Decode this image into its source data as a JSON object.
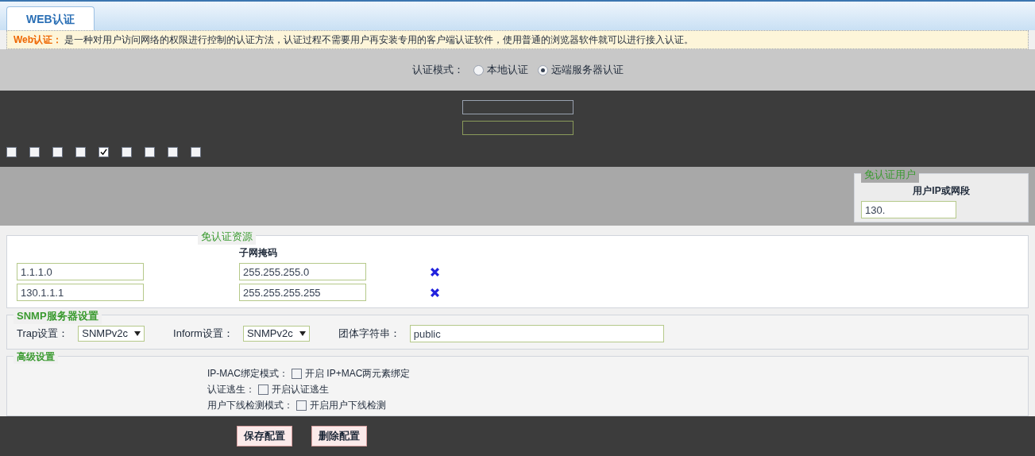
{
  "tab": {
    "label": "WEB认证",
    "selected": true
  },
  "notice": {
    "title": "Web认证：",
    "text": "是一种对用户访问网络的权限进行控制的认证方法，认证过程不需要用户再安装专用的客户端认证软件，使用普通的浏览器软件就可以进行接入认证。"
  },
  "auth_mode": {
    "label": "认证模式：",
    "options": [
      {
        "label": "本地认证",
        "selected": false
      },
      {
        "label": "远端服务器认证",
        "selected": true
      }
    ]
  },
  "port_checkboxes": [
    {
      "checked": false
    },
    {
      "checked": false
    },
    {
      "checked": false
    },
    {
      "checked": false
    },
    {
      "checked": true
    },
    {
      "checked": false
    },
    {
      "checked": false
    },
    {
      "checked": false
    },
    {
      "checked": false
    }
  ],
  "exempt_users": {
    "title": "免认证用户",
    "column": "用户IP或网段",
    "rows": [
      {
        "ip": "130."
      }
    ]
  },
  "exempt_resources": {
    "title": "免认证资源",
    "mask_column": "子网掩码",
    "rows": [
      {
        "ip": "1.1.1.0",
        "mask": "255.255.255.0"
      },
      {
        "ip": "130.1.1.1",
        "mask": "255.255.255.255"
      }
    ]
  },
  "snmp": {
    "title": "SNMP服务器设置",
    "trap_label": "Trap设置：",
    "trap_value": "SNMPv2c",
    "inform_label": "Inform设置：",
    "inform_value": "SNMPv2c",
    "community_label": "团体字符串：",
    "community_value": "public"
  },
  "advanced": {
    "title": "高级设置",
    "options": [
      {
        "label": "IP-MAC绑定模式：",
        "option": "开启 IP+MAC两元素绑定",
        "checked": false
      },
      {
        "label": "认证逃生：",
        "option": "开启认证逃生",
        "checked": false
      },
      {
        "label": "用户下线检测模式：",
        "option": "开启用户下线检测",
        "checked": false
      }
    ]
  },
  "buttons": [
    "保存配置",
    "删除配置"
  ]
}
